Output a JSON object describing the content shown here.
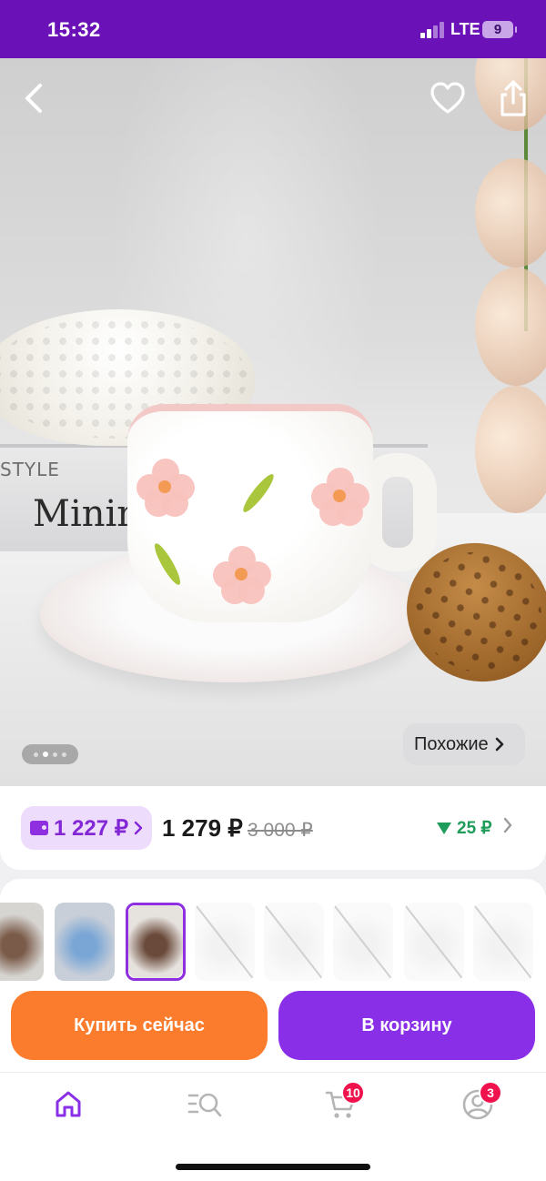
{
  "status_bar": {
    "time": "15:32",
    "network": "LTE",
    "battery": "9"
  },
  "hero": {
    "book_text_top": "STYLE",
    "book_text_main": "Minim",
    "similar_label": "Похожие",
    "pager": {
      "count": 4,
      "active": 1
    }
  },
  "price": {
    "wallet_price": "1 227 ₽",
    "current_price": "1 279 ₽",
    "old_price": "3 000 ₽",
    "bonus": "25 ₽"
  },
  "variants": [
    {
      "name": "variant-1",
      "available": true,
      "selected": false,
      "palette": [
        "#7a5a48",
        "#d7d5d2"
      ]
    },
    {
      "name": "variant-2",
      "available": true,
      "selected": false,
      "palette": [
        "#7aa6d6",
        "#c9cfd8"
      ]
    },
    {
      "name": "variant-3",
      "available": true,
      "selected": true,
      "palette": [
        "#6a4a3a",
        "#e6e2de"
      ]
    },
    {
      "name": "variant-4",
      "available": false,
      "selected": false,
      "palette": [
        "#d9d9d9",
        "#efefef"
      ]
    },
    {
      "name": "variant-5",
      "available": false,
      "selected": false,
      "palette": [
        "#d9d9d9",
        "#efefef"
      ]
    },
    {
      "name": "variant-6",
      "available": false,
      "selected": false,
      "palette": [
        "#d9d9d9",
        "#efefef"
      ]
    },
    {
      "name": "variant-7",
      "available": false,
      "selected": false,
      "palette": [
        "#d9d9d9",
        "#efefef"
      ]
    },
    {
      "name": "variant-8",
      "available": false,
      "selected": false,
      "palette": [
        "#d9d9d9",
        "#efefef"
      ]
    }
  ],
  "actions": {
    "buy_now": "Купить сейчас",
    "add_to_cart": "В корзину"
  },
  "tabbar": {
    "cart_badge": "10",
    "profile_badge": "3"
  },
  "colors": {
    "brand": "#6a12b8",
    "accent_purple": "#8a2fe8",
    "accent_orange": "#fb7c2c",
    "bonus_green": "#1f9c5a",
    "badge_red": "#f0124c"
  }
}
